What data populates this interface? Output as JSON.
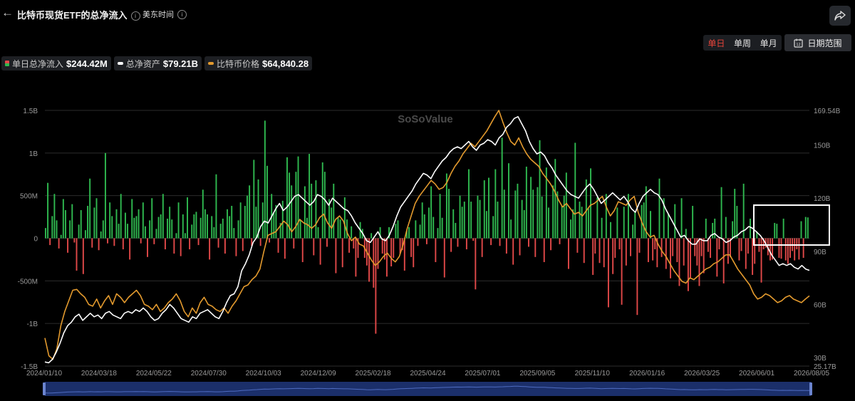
{
  "header": {
    "back_icon": "←",
    "title": "比特币现货ETF的总净流入",
    "timezone": "美东时间"
  },
  "toolbar": {
    "tabs": [
      {
        "label": "单日",
        "active": true
      },
      {
        "label": "单周",
        "active": false
      },
      {
        "label": "单月",
        "active": false
      }
    ],
    "date_range_label": "日期范围"
  },
  "legend": [
    {
      "label": "单日总净流入",
      "value": "$244.42M",
      "color": "#2fb84f"
    },
    {
      "label": "总净资产",
      "value": "$79.21B",
      "color": "#ffffff"
    },
    {
      "label": "比特币价格",
      "value": "$64,840.28",
      "color": "#e39a2e"
    }
  ],
  "watermark": "SoSoValue",
  "chart_data": {
    "type": "bar",
    "x_ticks": [
      "2024/01/10",
      "2024/03/18",
      "2024/05/22",
      "2024/07/30",
      "2024/10/03",
      "2024/12/09",
      "2025/02/18",
      "2025/04/24",
      "2025/07/01",
      "2025/09/05",
      "2025/11/10",
      "2026/01/16",
      "2026/03/25",
      "2026/06/01",
      "2026/08/05"
    ],
    "y_left_ticks": [
      "1.5B",
      "1B",
      "500M",
      "0",
      "-500M",
      "-1B",
      "-1.5B"
    ],
    "y_left_range": [
      -1500,
      1500
    ],
    "y_right_ticks": [
      "169.54B",
      "150B",
      "120B",
      "90B",
      "60B",
      "30B",
      "25.17B"
    ],
    "y_right_range": [
      25.17,
      169.54
    ],
    "colors": {
      "inflow": "#2fb84f",
      "outflow": "#e04848",
      "assets": "#ffffff",
      "price": "#e39a2e"
    },
    "series": [
      {
        "name": "单日总净流入",
        "unit": "M USD",
        "values": [
          120,
          650,
          -80,
          260,
          520,
          210,
          -120,
          40,
          460,
          330,
          -170,
          210,
          400,
          -50,
          -380,
          160,
          330,
          -420,
          95,
          380,
          700,
          -110,
          360,
          470,
          -140,
          80,
          210,
          1000,
          -60,
          420,
          260,
          -90,
          340,
          170,
          520,
          -130,
          300,
          170,
          -250,
          460,
          240,
          260,
          340,
          -60,
          420,
          140,
          -220,
          210,
          470,
          -70,
          110,
          250,
          280,
          520,
          -130,
          230,
          370,
          220,
          -180,
          60,
          420,
          -210,
          280,
          60,
          480,
          -130,
          160,
          280,
          310,
          -80,
          240,
          570,
          340,
          280,
          -250,
          260,
          130,
          750,
          -110,
          170,
          230,
          -180,
          340,
          260,
          380,
          120,
          -210,
          210,
          420,
          -150,
          380,
          500,
          620,
          -90,
          920,
          370,
          690,
          -90,
          420,
          1380,
          850,
          -50,
          520,
          300,
          390,
          -170,
          180,
          440,
          -240,
          950,
          770,
          620,
          -120,
          780,
          960,
          210,
          -280,
          610,
          240,
          990,
          640,
          -200,
          680,
          130,
          -310,
          890,
          780,
          -100,
          460,
          360,
          640,
          -410,
          250,
          220,
          -340,
          480,
          220,
          -170,
          140,
          -120,
          -450,
          -230,
          190,
          110,
          -230,
          -320,
          -510,
          60,
          -580,
          -1120,
          -360,
          130,
          -180,
          -250,
          -450,
          130,
          -330,
          -230,
          170,
          210,
          -180,
          -140,
          -380,
          90,
          130,
          -220,
          -340,
          210,
          -90,
          160,
          420,
          280,
          -70,
          360,
          610,
          250,
          -280,
          120,
          520,
          240,
          -460,
          760,
          580,
          -160,
          340,
          180,
          -100,
          500,
          370,
          430,
          -130,
          810,
          430,
          -30,
          -600,
          500,
          450,
          -220,
          680,
          320,
          710,
          -80,
          260,
          810,
          430,
          -90,
          1180,
          570,
          -180,
          880,
          220,
          -310,
          560,
          640,
          -200,
          450,
          330,
          840,
          -100,
          720,
          570,
          -220,
          600,
          1150,
          490,
          -280,
          830,
          360,
          -140,
          620,
          930,
          550,
          -70,
          380,
          500,
          770,
          -360,
          220,
          340,
          1120,
          -170,
          430,
          370,
          -290,
          690,
          350,
          820,
          -430,
          -180,
          480,
          -290,
          240,
          -340,
          520,
          -810,
          190,
          -420,
          -230,
          360,
          -130,
          -780,
          370,
          -320,
          520,
          -210,
          160,
          310,
          -900,
          -170,
          390,
          420,
          610,
          -280,
          320,
          -260,
          -130,
          -340,
          700,
          -220,
          470,
          -360,
          290,
          -470,
          -210,
          400,
          -280,
          -560,
          470,
          -320,
          110,
          -620,
          -460,
          380,
          -210,
          -320,
          -560,
          -210,
          -410,
          230,
          -160,
          -230,
          180,
          230,
          -450,
          -130,
          600,
          -530,
          250,
          -300,
          -220,
          200,
          580,
          380,
          -260,
          -150,
          640,
          -360,
          -180,
          230,
          -430,
          -300,
          80,
          -160,
          -520,
          -130,
          -110,
          -200,
          -260,
          -250,
          180,
          170,
          -230,
          -240,
          230,
          -260,
          -300,
          -230,
          -150,
          -260,
          -130,
          -250,
          200,
          -230,
          250,
          244.42
        ]
      },
      {
        "name": "总净资产",
        "unit": "B USD",
        "values": [
          27.5,
          27,
          29,
          33,
          38,
          44,
          48,
          50,
          53,
          54.5,
          51,
          53,
          55,
          53,
          54,
          52,
          55,
          56,
          54,
          53,
          52,
          55,
          56,
          55,
          57,
          56,
          58,
          56,
          53,
          51,
          52,
          55,
          57,
          60,
          58,
          55,
          52,
          51,
          50,
          53,
          52,
          55,
          56,
          57,
          55,
          53,
          52,
          56,
          61,
          65,
          66,
          70,
          79,
          83,
          88,
          95,
          98,
          104,
          107,
          106,
          110,
          114,
          117,
          113,
          115,
          118,
          121,
          122,
          120,
          118,
          116,
          118,
          122,
          121,
          119,
          116,
          120,
          118,
          116,
          114,
          113,
          110,
          106,
          103,
          100,
          96,
          95,
          98,
          101,
          97,
          96,
          99,
          104,
          110,
          115,
          118,
          121,
          124,
          128,
          131,
          134,
          133,
          131,
          135,
          138,
          141,
          143,
          146,
          148,
          149,
          148,
          150,
          152,
          149,
          147,
          150,
          151,
          153,
          152,
          150,
          154,
          156,
          160,
          162,
          165,
          166,
          162,
          158,
          152,
          148,
          145,
          146,
          144,
          140,
          137,
          133,
          130,
          127,
          124,
          122,
          121,
          120,
          123,
          126,
          128,
          125,
          121,
          117,
          119,
          121,
          123,
          121,
          119,
          121,
          118,
          114,
          112,
          117,
          121,
          123,
          125,
          123,
          122,
          119,
          114,
          110,
          106,
          102,
          98,
          99,
          96,
          94,
          94,
          97,
          96,
          96,
          99,
          100,
          98,
          97,
          95,
          96,
          98,
          99,
          101,
          102,
          104,
          103,
          101,
          99,
          96,
          92,
          88,
          85,
          82,
          83,
          82,
          83,
          81,
          80,
          82,
          80,
          79.21
        ]
      },
      {
        "name": "比特币价格",
        "unit": "B (right-axis scaled)",
        "values": [
          41,
          31,
          29,
          35,
          48,
          56,
          62,
          68,
          68.5,
          66,
          64,
          60,
          59,
          63,
          58,
          62,
          65,
          60,
          66,
          64,
          61,
          64,
          66,
          68,
          65,
          60,
          59,
          57,
          60,
          56,
          58,
          61,
          63,
          66,
          62,
          56,
          53,
          58,
          55,
          61,
          64,
          60,
          59,
          57,
          56,
          58,
          55,
          59,
          62,
          66,
          70,
          71,
          74,
          76,
          80,
          90,
          99,
          100,
          101,
          104,
          107,
          105,
          101,
          104,
          108,
          106,
          105,
          103,
          105,
          109,
          111,
          106,
          103,
          108,
          110,
          107,
          100,
          96,
          98,
          94,
          93,
          89,
          85,
          82,
          84,
          87,
          89,
          86,
          84,
          87,
          94,
          103,
          110,
          117,
          121,
          124,
          127,
          130,
          128,
          125,
          126,
          129,
          134,
          138,
          141,
          145,
          148,
          151,
          149,
          152,
          155,
          158,
          162,
          166,
          169.54,
          163,
          157,
          152,
          150,
          154,
          149,
          145,
          142,
          140,
          138,
          134,
          131,
          128,
          124,
          119,
          115,
          117,
          114,
          111,
          112,
          110,
          113,
          116,
          117,
          119,
          121,
          115,
          110,
          113,
          118,
          117,
          116,
          119,
          121,
          112,
          106,
          101,
          98,
          99,
          94,
          90,
          87,
          83,
          79,
          76,
          73,
          72,
          75,
          74,
          76,
          78,
          80,
          81,
          83,
          84,
          86,
          88,
          88,
          84,
          80,
          77,
          74,
          71,
          66,
          63,
          64,
          66,
          65,
          63,
          61,
          62,
          64,
          65,
          63,
          62,
          61,
          63,
          64.84
        ]
      }
    ]
  }
}
